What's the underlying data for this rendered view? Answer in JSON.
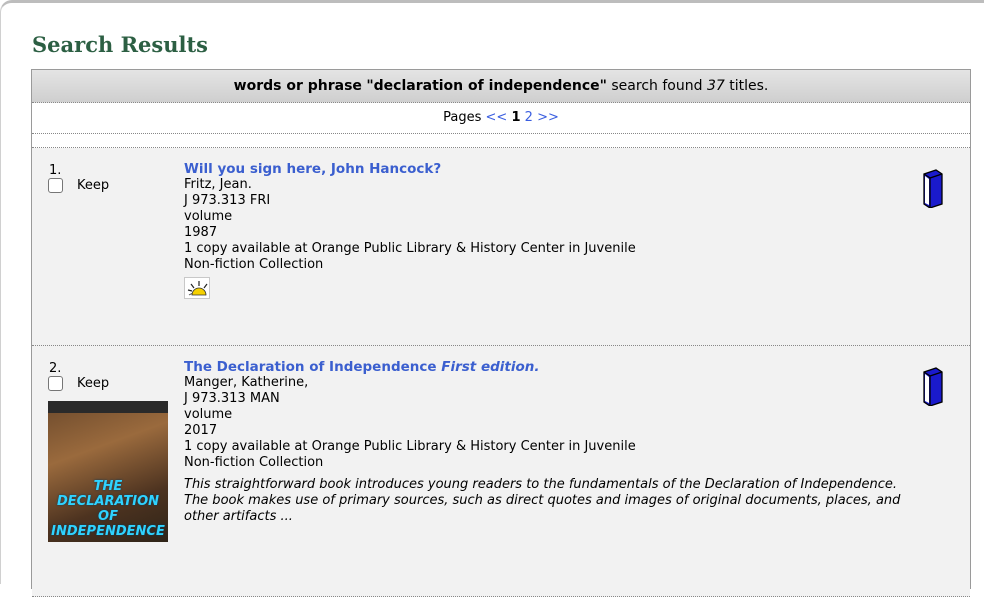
{
  "page": {
    "heading": "Search Results"
  },
  "summary": {
    "query_type": "words or phrase",
    "query": "\"declaration of independence\"",
    "found_text": "search found",
    "count": "37",
    "suffix": "titles."
  },
  "pager": {
    "label": "Pages",
    "prev": "<<",
    "pages": [
      "1",
      "2"
    ],
    "current": "1",
    "next": ">>"
  },
  "results": [
    {
      "number": "1.",
      "keep_label": "Keep",
      "title": "Will you sign here, John Hancock?",
      "edition": "",
      "author": "Fritz, Jean.",
      "call_number": "J 973.313 FRI",
      "format": "volume",
      "year": "1987",
      "availability_line1": "1 copy available at Orange Public Library & History Center in Juvenile",
      "availability_line2": "Non-fiction Collection",
      "description": "",
      "icons": [
        "book-volume-icon",
        "review-sun-icon"
      ]
    },
    {
      "number": "2.",
      "keep_label": "Keep",
      "title": "The Declaration of Independence",
      "edition": "First edition.",
      "author": "Manger, Katherine,",
      "call_number": "J 973.313 MAN",
      "format": "volume",
      "year": "2017",
      "availability_line1": "1 copy available at Orange Public Library & History Center in Juvenile",
      "availability_line2": "Non-fiction Collection",
      "description": "This straightforward book introduces young readers to the fundamentals of the Declaration of Independence. The book makes use of primary sources, such as direct quotes and images of original documents, places, and other artifacts ...",
      "cover": {
        "title_line1": "THE",
        "title_line2": "DECLARATION OF",
        "title_line3": "INDEPENDENCE"
      },
      "icons": [
        "book-volume-icon",
        "book-cover-image"
      ]
    }
  ],
  "colors": {
    "heading": "#2c5f43",
    "link": "#3b5fcf",
    "book_icon": "#1a1acc",
    "result_bg": "#f2f2f2"
  }
}
